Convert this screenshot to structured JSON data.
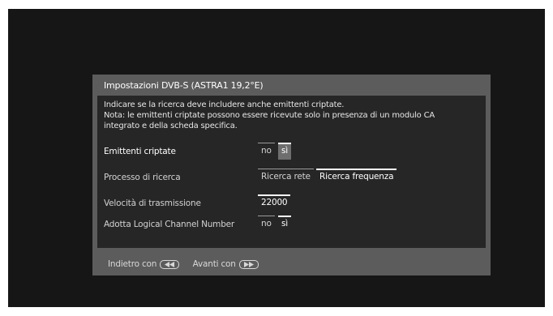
{
  "dialog": {
    "title": "Impostazioni DVB-S (ASTRA1 19,2°E)",
    "info": [
      "Indicare se la ricerca deve includere anche emittenti criptate.",
      "Nota: le emittenti criptate possono essere ricevute solo in presenza di un modulo CA",
      "integrato e della scheda specifica."
    ]
  },
  "settings": {
    "encrypted": {
      "label": "Emittenti criptate",
      "options": [
        "no",
        "sì"
      ],
      "selected": "sì"
    },
    "search_process": {
      "label": "Processo di ricerca",
      "options": [
        "Ricerca rete",
        "Ricerca frequenza"
      ],
      "selected": "Ricerca frequenza"
    },
    "symbol_rate": {
      "label": "Velocità di trasmissione",
      "value": "22000"
    },
    "lcn": {
      "label": "Adotta Logical Channel Number",
      "options": [
        "no",
        "sì"
      ],
      "selected": "sì"
    }
  },
  "footer": {
    "back_label": "Indietro con",
    "back_icon": "rewind-button-icon",
    "forward_label": "Avanti con",
    "forward_icon": "fast-forward-button-icon"
  },
  "colors": {
    "screen_bg": "#161616",
    "dialog_frame": "#5c5c5c",
    "content_bg": "#262626",
    "highlight": "#6e6e6e"
  }
}
